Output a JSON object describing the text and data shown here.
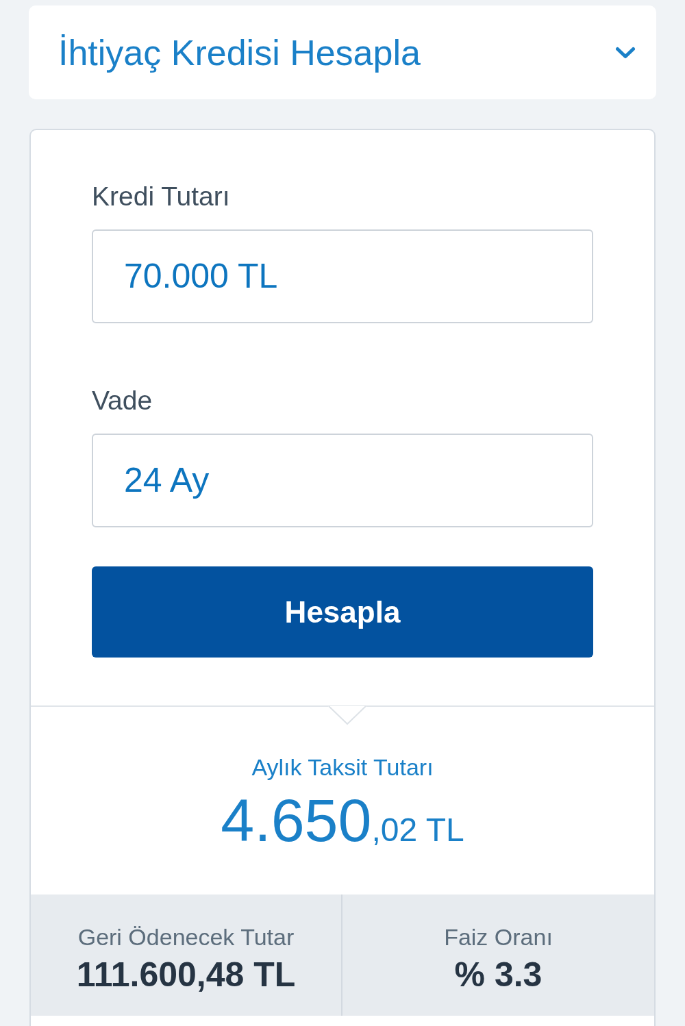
{
  "header": {
    "title": "İhtiyaç Kredisi Hesapla"
  },
  "form": {
    "fields": [
      {
        "label": "Kredi Tutarı",
        "value": "70.000 TL"
      },
      {
        "label": "Vade",
        "value": "24 Ay"
      }
    ],
    "button": "Hesapla"
  },
  "result": {
    "label": "Aylık Taksit Tutarı",
    "amount": "4.650",
    "amount_decimals": ",02 TL"
  },
  "summary": [
    {
      "label": "Geri Ödenecek Tutar",
      "value": "111.600,48 TL"
    },
    {
      "label": "Faiz Oranı",
      "value": "% 3.3"
    }
  ]
}
